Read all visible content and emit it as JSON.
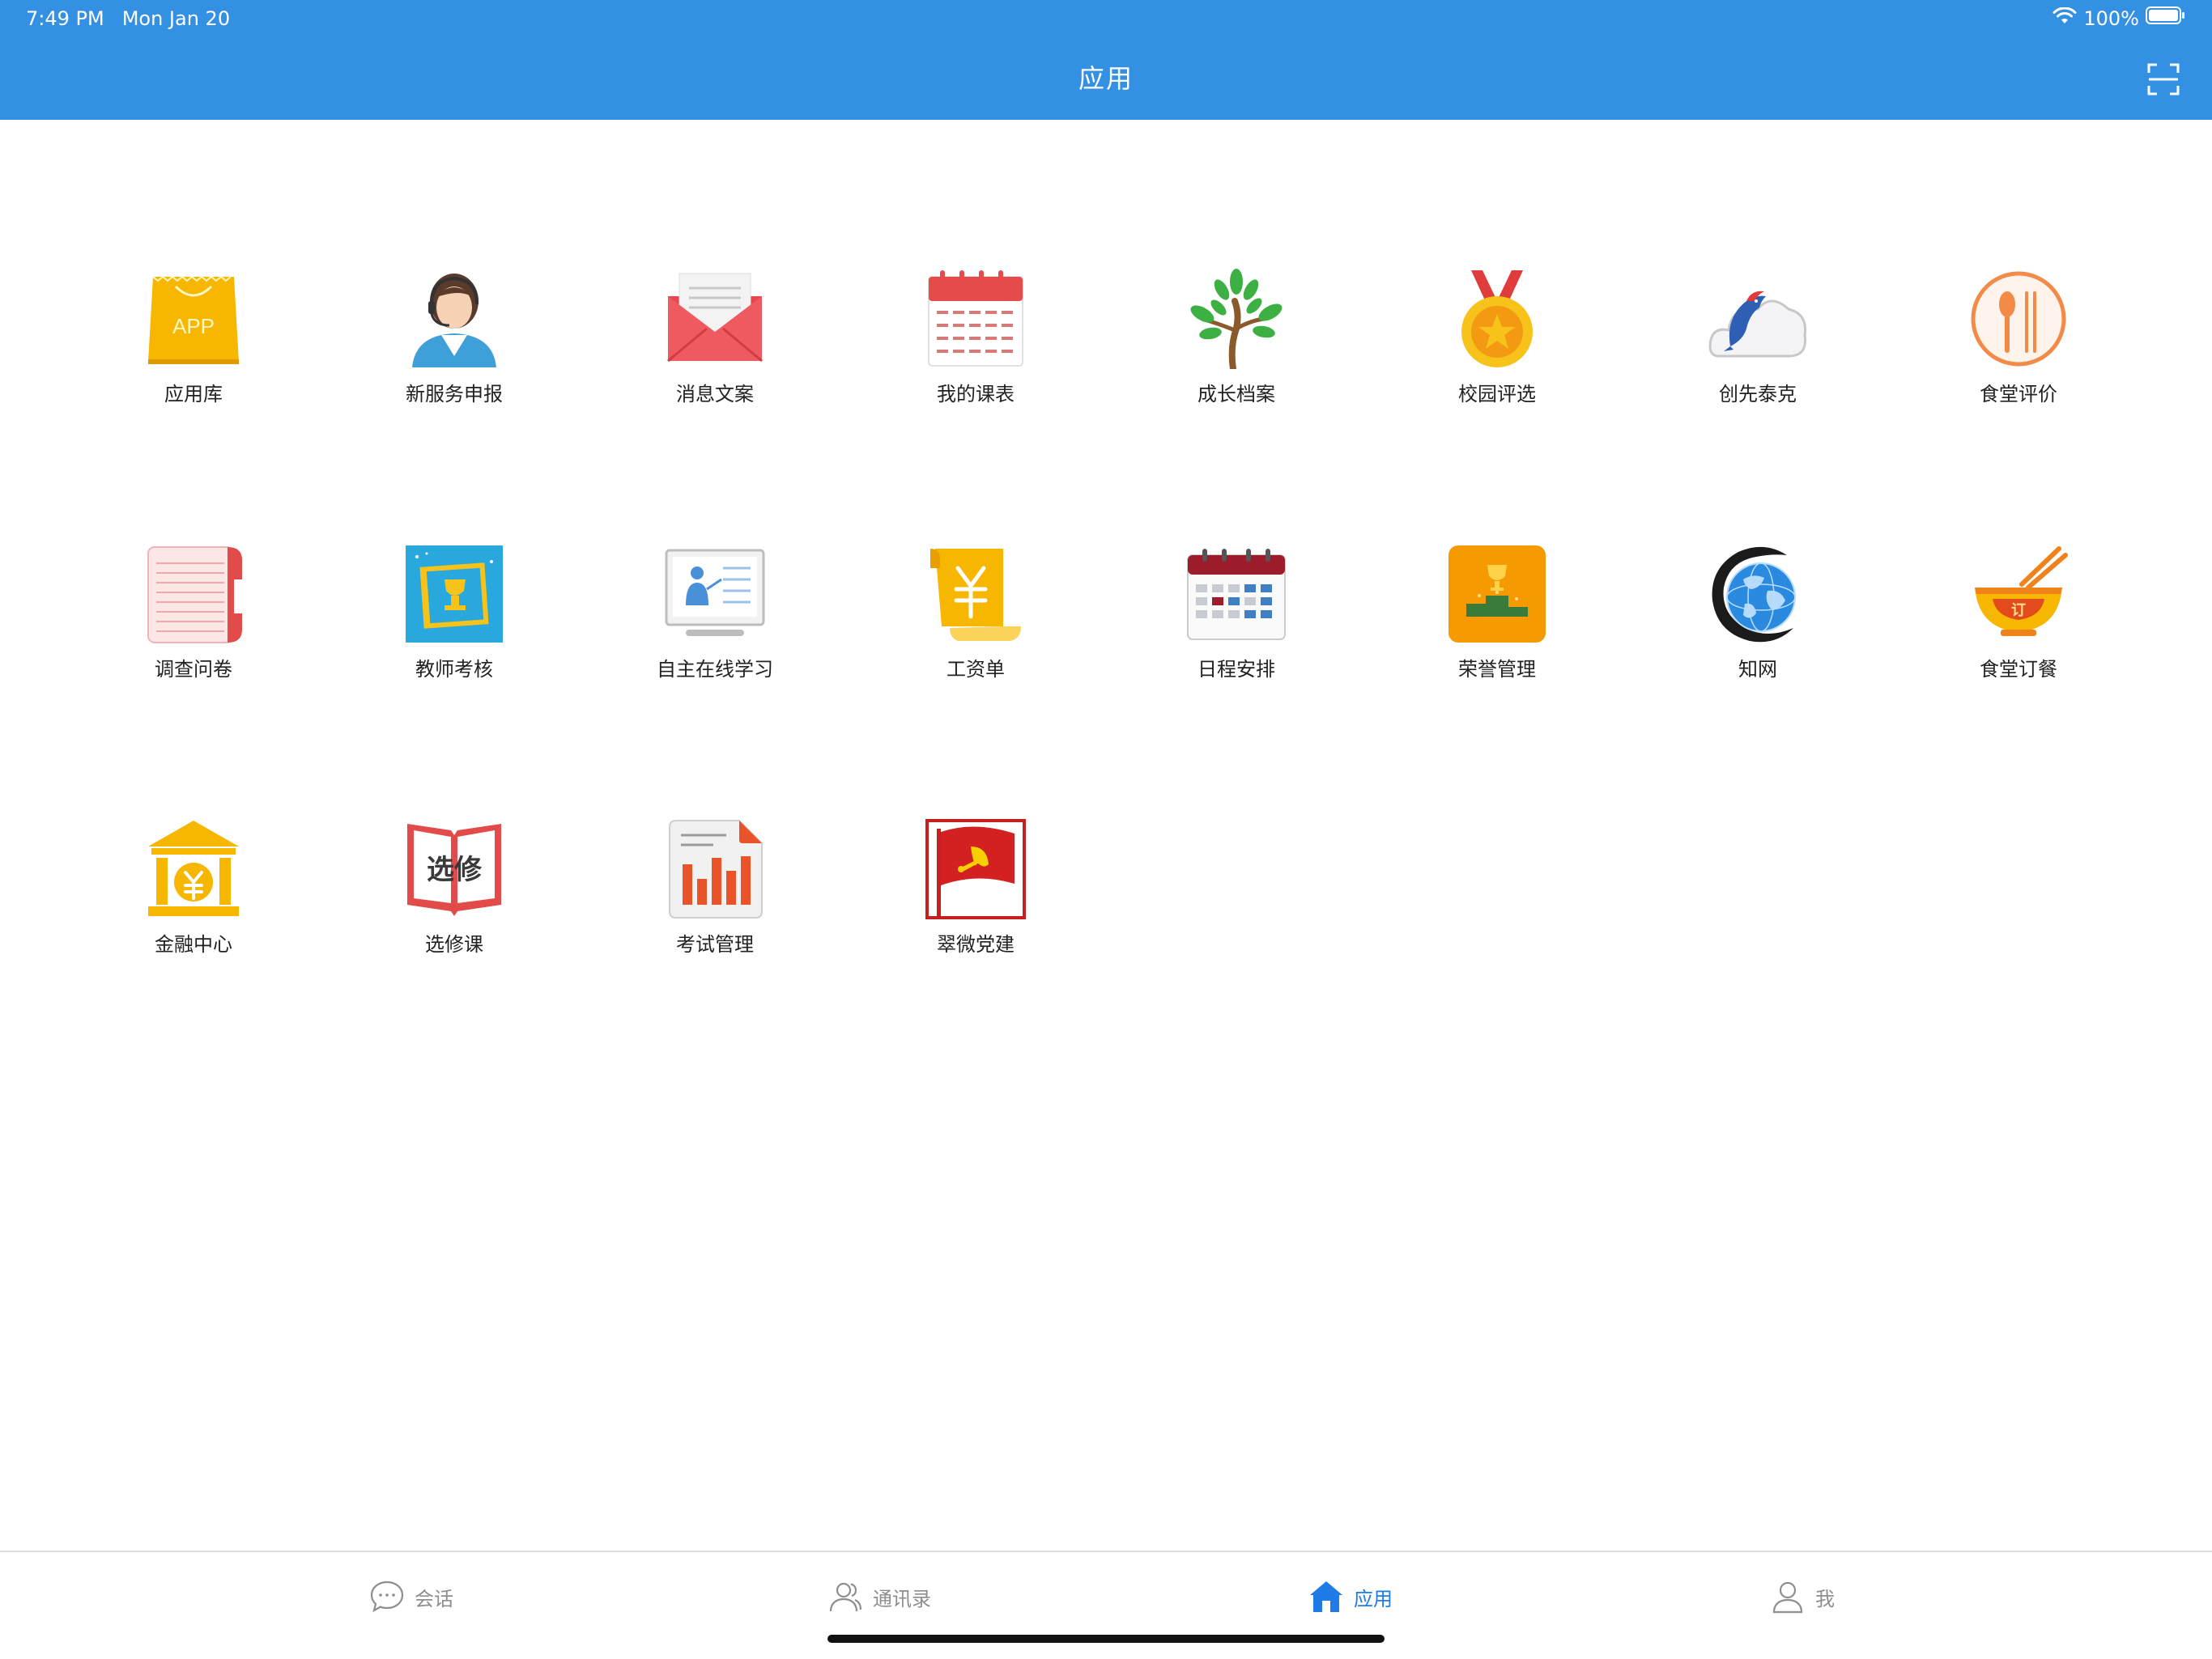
{
  "status_bar": {
    "time": "7:49 PM",
    "date": "Mon Jan 20",
    "battery": "100%"
  },
  "header": {
    "title": "应用",
    "background": "#3390e3",
    "scan_icon": "scan-icon"
  },
  "apps": [
    {
      "label": "应用库",
      "icon": "app-store-icon"
    },
    {
      "label": "新服务申报",
      "icon": "service-agent-icon"
    },
    {
      "label": "消息文案",
      "icon": "message-envelope-icon"
    },
    {
      "label": "我的课表",
      "icon": "calendar-schedule-icon"
    },
    {
      "label": "成长档案",
      "icon": "growth-tree-icon"
    },
    {
      "label": "校园评选",
      "icon": "medal-icon"
    },
    {
      "label": "创先泰克",
      "icon": "dolphin-cloud-icon"
    },
    {
      "label": "食堂评价",
      "icon": "spoon-fork-icon"
    },
    {
      "label": "调查问卷",
      "icon": "survey-notebook-icon"
    },
    {
      "label": "教师考核",
      "icon": "trophy-photo-icon"
    },
    {
      "label": "自主在线学习",
      "icon": "online-teacher-icon"
    },
    {
      "label": "工资单",
      "icon": "salary-scroll-icon"
    },
    {
      "label": "日程安排",
      "icon": "calendar-agenda-icon"
    },
    {
      "label": "荣誉管理",
      "icon": "honor-podium-icon"
    },
    {
      "label": "知网",
      "icon": "globe-icon"
    },
    {
      "label": "食堂订餐",
      "icon": "order-bowl-icon"
    },
    {
      "label": "金融中心",
      "icon": "bank-icon"
    },
    {
      "label": "选修课",
      "icon": "elective-book-icon"
    },
    {
      "label": "考试管理",
      "icon": "exam-chart-icon"
    },
    {
      "label": "翠微党建",
      "icon": "party-flag-icon"
    }
  ],
  "tabbar": {
    "tabs": [
      {
        "label": "会话",
        "icon": "chat-bubble-icon",
        "active": false
      },
      {
        "label": "通讯录",
        "icon": "contacts-icon",
        "active": false
      },
      {
        "label": "应用",
        "icon": "home-icon",
        "active": true
      },
      {
        "label": "我",
        "icon": "profile-icon",
        "active": false
      }
    ],
    "active_color": "#1f7ce6",
    "inactive_color": "#8e8e8e"
  }
}
